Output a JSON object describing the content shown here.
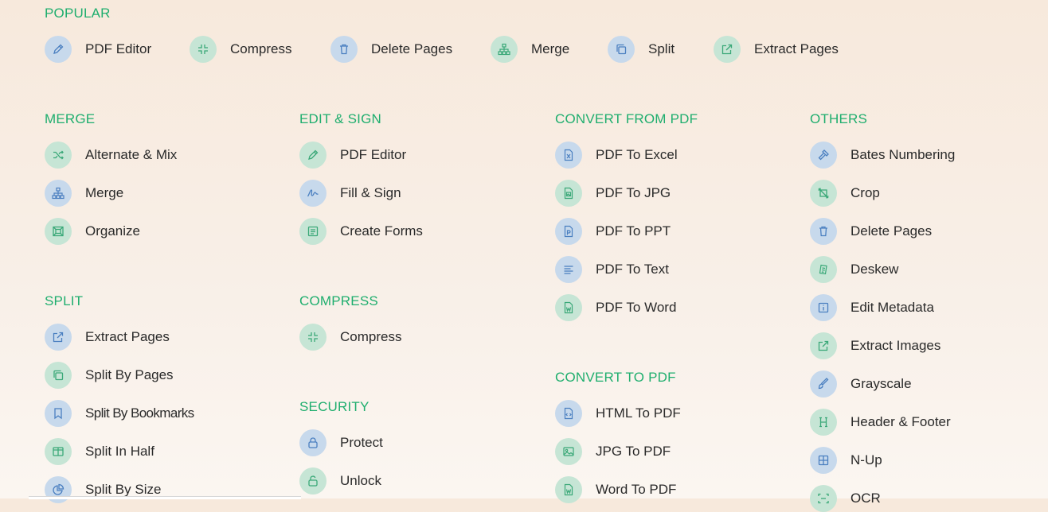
{
  "sections": {
    "popular": {
      "title": "POPULAR",
      "items": [
        {
          "label": "PDF Editor",
          "icon": "pencil-icon",
          "color": "blue"
        },
        {
          "label": "Compress",
          "icon": "compress-icon",
          "color": "green"
        },
        {
          "label": "Delete Pages",
          "icon": "trash-icon",
          "color": "blue"
        },
        {
          "label": "Merge",
          "icon": "sitemap-icon",
          "color": "green"
        },
        {
          "label": "Split",
          "icon": "copy-icon",
          "color": "blue"
        },
        {
          "label": "Extract Pages",
          "icon": "external-link-icon",
          "color": "green"
        }
      ]
    },
    "merge": {
      "title": "MERGE",
      "items": [
        {
          "label": "Alternate & Mix",
          "icon": "shuffle-icon",
          "color": "green"
        },
        {
          "label": "Merge",
          "icon": "sitemap-icon",
          "color": "blue"
        },
        {
          "label": "Organize",
          "icon": "organize-icon",
          "color": "green"
        }
      ]
    },
    "split": {
      "title": "SPLIT",
      "items": [
        {
          "label": "Extract Pages",
          "icon": "external-link-icon",
          "color": "blue"
        },
        {
          "label": "Split By Pages",
          "icon": "copy-icon",
          "color": "green"
        },
        {
          "label": "Split By Bookmarks",
          "icon": "bookmark-icon",
          "color": "blue"
        },
        {
          "label": "Split In Half",
          "icon": "columns-icon",
          "color": "green"
        },
        {
          "label": "Split By Size",
          "icon": "pie-chart-icon",
          "color": "blue"
        }
      ]
    },
    "edit_sign": {
      "title": "EDIT & SIGN",
      "items": [
        {
          "label": "PDF Editor",
          "icon": "pencil-icon",
          "color": "green"
        },
        {
          "label": "Fill & Sign",
          "icon": "signature-icon",
          "color": "blue"
        },
        {
          "label": "Create Forms",
          "icon": "form-icon",
          "color": "green"
        }
      ]
    },
    "compress": {
      "title": "COMPRESS",
      "items": [
        {
          "label": "Compress",
          "icon": "compress-icon",
          "color": "green"
        }
      ]
    },
    "security": {
      "title": "SECURITY",
      "items": [
        {
          "label": "Protect",
          "icon": "lock-icon",
          "color": "blue"
        },
        {
          "label": "Unlock",
          "icon": "unlock-icon",
          "color": "green"
        }
      ]
    },
    "convert_from": {
      "title": "CONVERT FROM PDF",
      "items": [
        {
          "label": "PDF To Excel",
          "icon": "excel-file-icon",
          "color": "blue"
        },
        {
          "label": "PDF To JPG",
          "icon": "image-file-icon",
          "color": "green"
        },
        {
          "label": "PDF To PPT",
          "icon": "ppt-file-icon",
          "color": "blue"
        },
        {
          "label": "PDF To Text",
          "icon": "text-lines-icon",
          "color": "blue"
        },
        {
          "label": "PDF To Word",
          "icon": "word-file-icon",
          "color": "green"
        }
      ]
    },
    "convert_to": {
      "title": "CONVERT TO PDF",
      "items": [
        {
          "label": "HTML To PDF",
          "icon": "code-file-icon",
          "color": "blue"
        },
        {
          "label": "JPG To PDF",
          "icon": "image-icon",
          "color": "green"
        },
        {
          "label": "Word To PDF",
          "icon": "word-file-icon",
          "color": "green"
        }
      ]
    },
    "others": {
      "title": "OTHERS",
      "items": [
        {
          "label": "Bates Numbering",
          "icon": "stamp-icon",
          "color": "blue"
        },
        {
          "label": "Crop",
          "icon": "crop-icon",
          "color": "green"
        },
        {
          "label": "Delete Pages",
          "icon": "trash-icon",
          "color": "blue"
        },
        {
          "label": "Deskew",
          "icon": "deskew-icon",
          "color": "green"
        },
        {
          "label": "Edit Metadata",
          "icon": "info-icon",
          "color": "blue"
        },
        {
          "label": "Extract Images",
          "icon": "external-link-icon",
          "color": "green"
        },
        {
          "label": "Grayscale",
          "icon": "brush-icon",
          "color": "blue"
        },
        {
          "label": "Header & Footer",
          "icon": "header-icon",
          "color": "green"
        },
        {
          "label": "N-Up",
          "icon": "grid-icon",
          "color": "blue"
        },
        {
          "label": "OCR",
          "icon": "ocr-icon",
          "color": "green"
        }
      ]
    }
  },
  "colors": {
    "accent": "#1fae6e",
    "icon_blue_bg": "#c7d9ec",
    "icon_green_bg": "#c6e5d5"
  }
}
